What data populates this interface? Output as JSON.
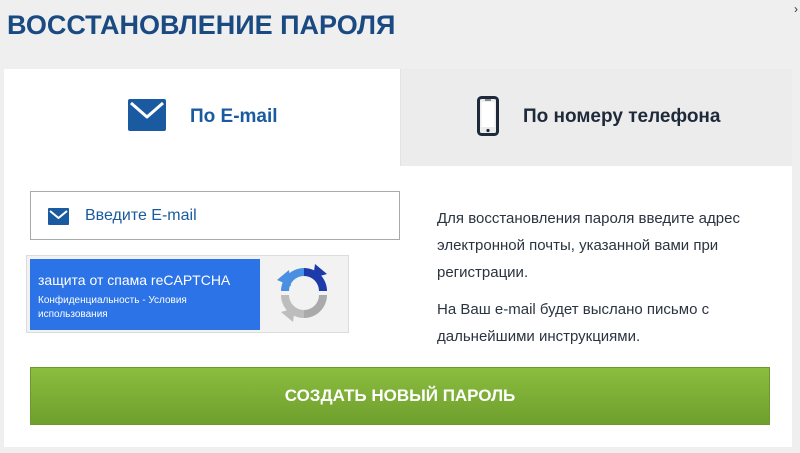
{
  "page": {
    "title": "ВОССТАНОВЛЕНИЕ ПАРОЛЯ",
    "close_glyph": "›"
  },
  "tabs": {
    "email": {
      "label": "По E-mail",
      "icon": "envelope-icon"
    },
    "phone": {
      "label": "По номеру телефона",
      "icon": "phone-icon"
    }
  },
  "email_field": {
    "placeholder": "Введите E-mail",
    "value": "",
    "icon": "envelope-icon"
  },
  "recaptcha": {
    "title": "защита от спама reCAPTCHA",
    "links": "Конфиденциальность - Условия использования",
    "icon": "recaptcha-logo-icon"
  },
  "info": {
    "paragraph_1": "Для восстановления пароля введите адрес электронной почты, указанной вами при регистрации.",
    "paragraph_2": "На Ваш e-mail будет выслано письмо с дальнейшими инструкциями."
  },
  "submit": {
    "label": "СОЗДАТЬ НОВЫЙ ПАРОЛЬ"
  },
  "colors": {
    "title": "#1a4a82",
    "active_tab_text": "#1a5aa0",
    "button_green": "#7aad33",
    "recaptcha_blue": "#2b73e6"
  }
}
